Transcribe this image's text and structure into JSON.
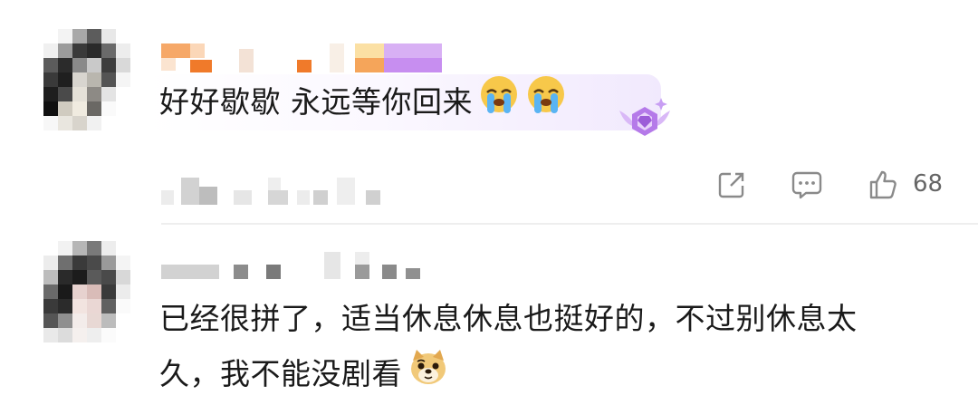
{
  "comments": [
    {
      "text": "好好歇歇 永远等你回来",
      "emoji_names": [
        "loudly-crying-face-icon",
        "loudly-crying-face-icon"
      ],
      "badge": "purple-crown-gem-badge-icon",
      "like_count": "68"
    },
    {
      "text_line1": "已经很拼了，适当休息休息也挺好的，不过别休息太",
      "text_line2": "久，我不能没剧看",
      "emoji_names": [
        "doge-icon"
      ]
    }
  ],
  "actions": {
    "share_icon": "share-icon",
    "reply_icon": "reply-bubble-icon",
    "like_icon": "thumbs-up-icon"
  }
}
